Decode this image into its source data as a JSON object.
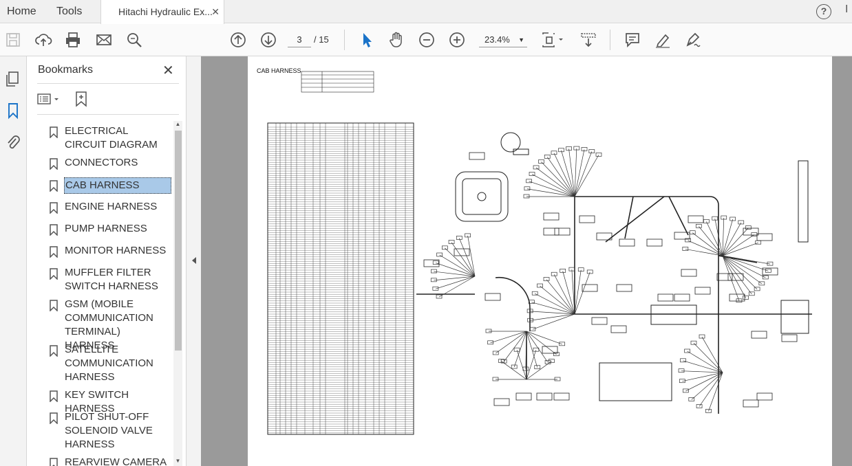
{
  "tabs": {
    "home": "Home",
    "tools": "Tools",
    "document": "Hitachi Hydraulic Ex...",
    "close": "✕"
  },
  "toolbar": {
    "icons": [
      "save-icon",
      "cloud-upload-icon",
      "print-icon",
      "email-icon",
      "find-icon",
      "page-up-icon",
      "page-down-icon",
      "select-pointer-icon",
      "hand-icon",
      "zoom-out-icon",
      "zoom-in-icon",
      "page-fit-icon",
      "scroll-mode-icon",
      "comment-icon",
      "highlight-pen-icon",
      "sign-icon"
    ],
    "page_current": "3",
    "page_total": "/ 15",
    "zoom": "23.4%"
  },
  "bookmarks": {
    "title": "Bookmarks",
    "items": [
      {
        "label": "ELECTRICAL CIRCUIT DIAGRAM"
      },
      {
        "label": "CONNECTORS"
      },
      {
        "label": "CAB HARNESS",
        "selected": true
      },
      {
        "label": "ENGINE HARNESS"
      },
      {
        "label": "PUMP HARNESS"
      },
      {
        "label": "MONITOR HARNESS"
      },
      {
        "label": "MUFFLER FILTER SWITCH HARNESS"
      },
      {
        "label": "GSM (MOBILE COMMUNICATION TERMINAL) HARNESS"
      },
      {
        "label": "SATELLITE COMMUNICATION HARNESS"
      },
      {
        "label": "KEY SWITCH HARNESS"
      },
      {
        "label": "PILOT SHUT-OFF SOLENOID VALVE HARNESS"
      },
      {
        "label": "REARVIEW CAMERA"
      }
    ]
  },
  "document": {
    "page_heading": "CAB HARNESS"
  },
  "colors": {
    "selection": "#a9c9e8",
    "accent_blue": "#1a73c8",
    "doc_bg": "#9a9a9a"
  }
}
